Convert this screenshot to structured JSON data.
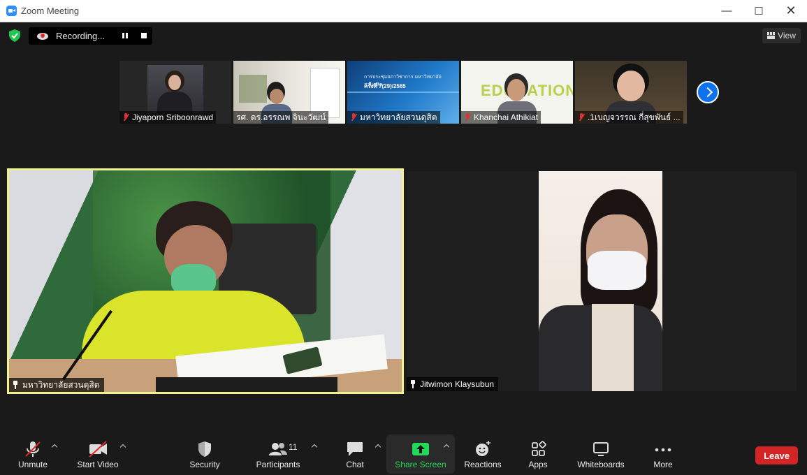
{
  "window": {
    "title": "Zoom Meeting"
  },
  "recording": {
    "label": "Recording..."
  },
  "view": {
    "label": "View"
  },
  "thumbnails": [
    {
      "name": "Jiyaporn Sriboonrawd"
    },
    {
      "name": "รศ. ดร.อรรณพ จินะวัฒน์"
    },
    {
      "name": "มหาวิทยาลัยสวนดุสิต"
    },
    {
      "name": "Khanchai Athikiat"
    },
    {
      "name": ".1เบญจวรรณ กี่สุขพันธ์ ..."
    }
  ],
  "thumb_slide_text": [
    "การประชุมสภาวิชาการ มหาวิทยาลัยสวนดุสิต",
    "ครั้งที่ 7(29)/2565"
  ],
  "thumb_edu_text": "EDUCATION",
  "main_tiles": [
    {
      "name": "มหาวิทยาลัยสวนดุสิต"
    },
    {
      "name": "Jitwimon Klaysubun"
    }
  ],
  "toolbar": {
    "unmute": "Unmute",
    "start_video": "Start Video",
    "security": "Security",
    "participants": "Participants",
    "participants_count": "11",
    "chat": "Chat",
    "share_screen": "Share Screen",
    "reactions": "Reactions",
    "apps": "Apps",
    "whiteboards": "Whiteboards",
    "more": "More",
    "leave": "Leave"
  },
  "colors": {
    "accent": "#0e72ed",
    "share_green": "#23d959",
    "leave_red": "#d32525",
    "active_speaker_border": "#f0f291"
  }
}
